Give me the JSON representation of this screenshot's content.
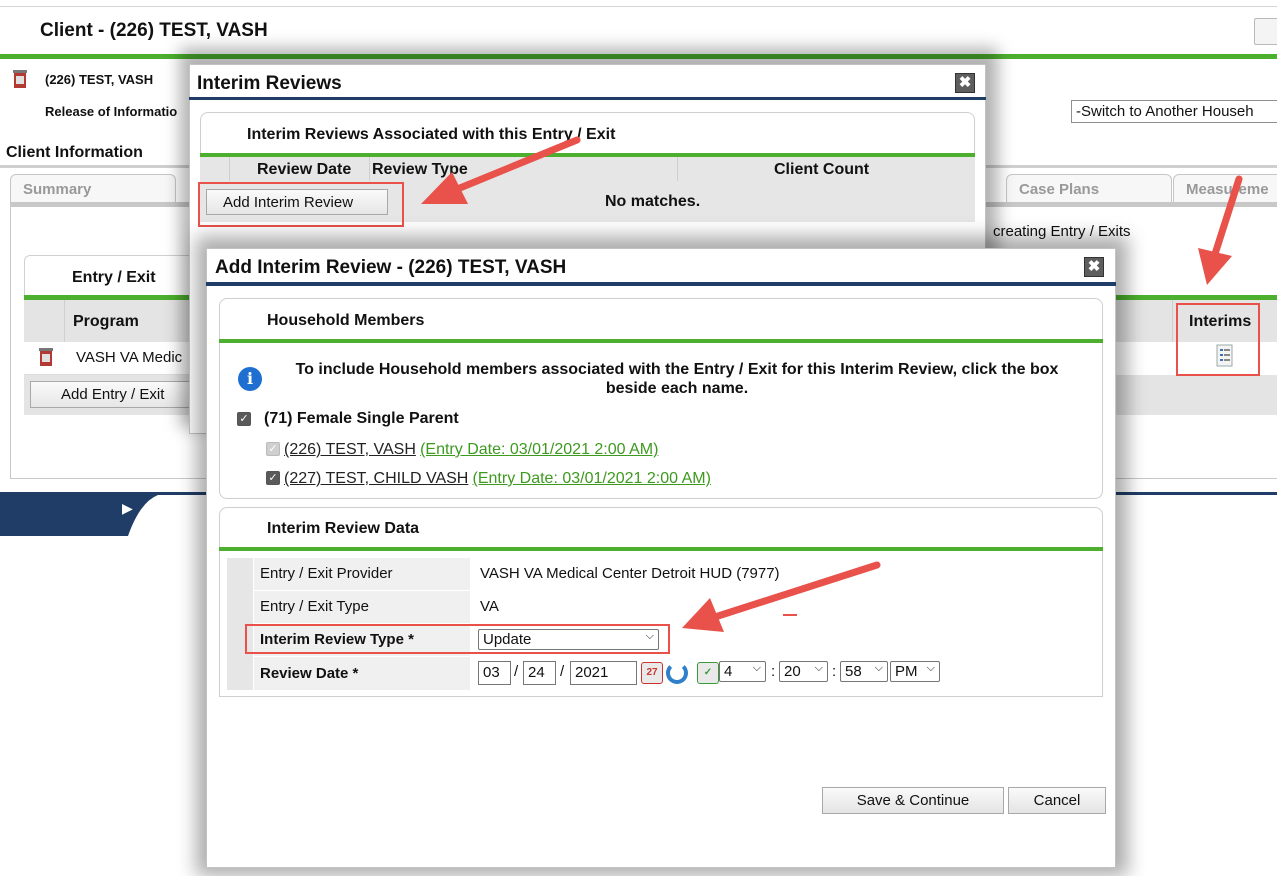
{
  "client_page": {
    "title": "Client - (226) TEST, VASH",
    "client_name": "(226) TEST, VASH",
    "release_of_information": "Release of Informatio",
    "switch_household": "-Switch to Another Househ",
    "client_information": "Client Information",
    "tabs": [
      "Summary",
      "Case Plans",
      "Measureme"
    ],
    "creating_entry_exits": "creating Entry / Exits",
    "entry_exit_title": "Entry / Exit",
    "program_col": "Program",
    "program_row": "VASH VA Medic",
    "add_entry_exit": "Add Entry / Exit",
    "interims_col": "Interims"
  },
  "interim_reviews_dialog": {
    "title": "Interim Reviews",
    "section_title": "Interim Reviews Associated with this Entry / Exit",
    "columns": [
      "Review Date",
      "Review Type",
      "Client Count"
    ],
    "add_button": "Add Interim Review",
    "empty_text": "No matches."
  },
  "add_interim_dialog": {
    "title": "Add Interim Review - (226) TEST, VASH",
    "household_section": "Household Members",
    "info_text": "To include Household members associated with the Entry / Exit for this Interim Review, click the box beside each name.",
    "household_name": "(71) Female Single Parent",
    "members": [
      {
        "name": "(226) TEST, VASH",
        "entry": "(Entry Date: 03/01/2021 2:00 AM)"
      },
      {
        "name": "(227) TEST, CHILD VASH",
        "entry": "(Entry Date: 03/01/2021 2:00 AM)"
      }
    ],
    "data_section": "Interim Review Data",
    "provider_label": "Entry / Exit Provider",
    "provider_value": "VASH VA Medical Center Detroit HUD (7977)",
    "type_label": "Entry / Exit Type",
    "type_value": "VA",
    "review_type_label": "Interim Review Type",
    "review_type_value": "Update",
    "review_date_label": "Review Date",
    "required_mark": "*",
    "date": {
      "month": "03",
      "day": "24",
      "year": "2021",
      "sep": "/"
    },
    "time": {
      "hour": "4",
      "minute": "20",
      "second": "58",
      "ampm": "PM",
      "sep": ":"
    },
    "save_button": "Save & Continue",
    "cancel_button": "Cancel"
  },
  "colors": {
    "accent_green": "#4caf2e",
    "navy": "#1f3d66",
    "annotation_red": "#e8524a",
    "link_green": "#3d9a1f"
  },
  "icons": [
    "trash-can-icon",
    "close-icon",
    "info-icon",
    "calendar-icon",
    "refresh-icon",
    "calendar-check-icon",
    "document-list-icon",
    "chevron-down-icon"
  ]
}
